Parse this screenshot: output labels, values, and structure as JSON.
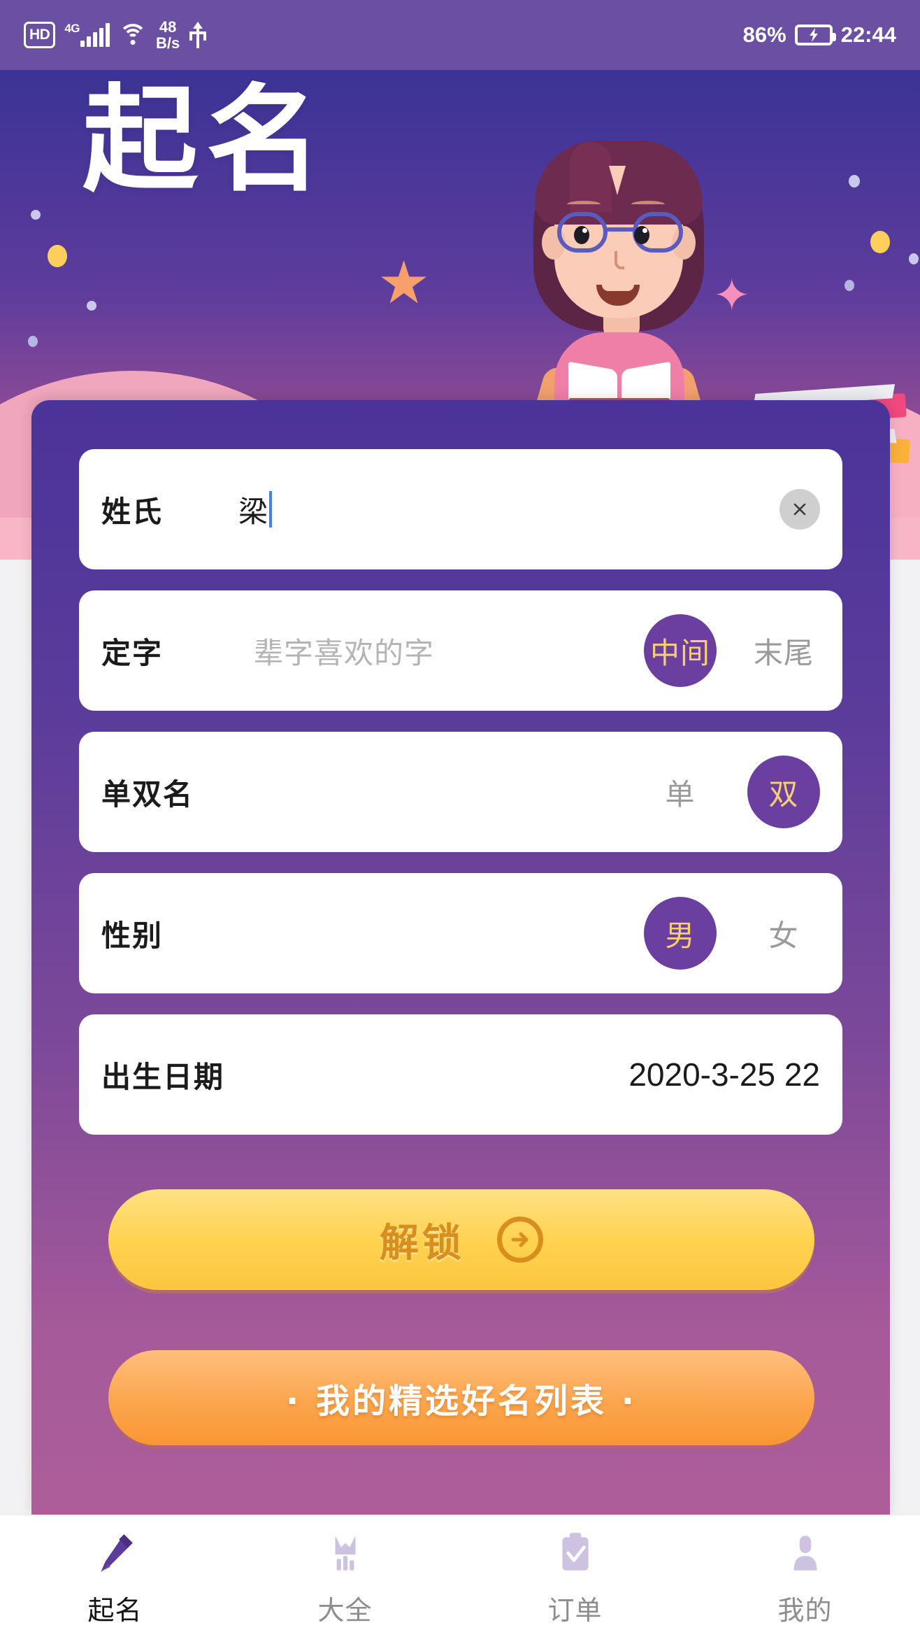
{
  "statusbar": {
    "hd": "HD",
    "network": "4G",
    "speed_value": "48",
    "speed_unit": "B/s",
    "battery_pct": "86%",
    "time": "22:44"
  },
  "hero": {
    "title": "起名"
  },
  "form": {
    "surname": {
      "label": "姓氏",
      "value": "梁",
      "clear_label": "×"
    },
    "fixed_char": {
      "label": "定字",
      "placeholder": "辈字喜欢的字",
      "value": "",
      "options": [
        {
          "label": "中间",
          "selected": true
        },
        {
          "label": "末尾",
          "selected": false
        }
      ]
    },
    "name_length": {
      "label": "单双名",
      "options": [
        {
          "label": "单",
          "selected": false
        },
        {
          "label": "双",
          "selected": true
        }
      ]
    },
    "gender": {
      "label": "性别",
      "options": [
        {
          "label": "男",
          "selected": true
        },
        {
          "label": "女",
          "selected": false
        }
      ]
    },
    "birthdate": {
      "label": "出生日期",
      "value": "2020-3-25 22"
    }
  },
  "actions": {
    "unlock": "解锁",
    "unlock_icon": "arrow-right-circle-icon",
    "my_list": "· 我的精选好名列表 ·"
  },
  "nav": {
    "items": [
      {
        "label": "起名",
        "icon": "pen-icon",
        "active": true
      },
      {
        "label": "大全",
        "icon": "book-collection-icon",
        "active": false
      },
      {
        "label": "订单",
        "icon": "clipboard-check-icon",
        "active": false
      },
      {
        "label": "我的",
        "icon": "person-icon",
        "active": false
      }
    ]
  },
  "colors": {
    "status_bar": "#6a4fa3",
    "hero_top": "#3b3396",
    "panel_top": "#4a3399",
    "panel_bottom": "#ad5e9a",
    "selected_chip": "#6b3fa0",
    "selected_text": "#f7cd74",
    "unlock_button": "#ffd24f",
    "unlock_text": "#d88f1e",
    "list_button": "#fba64d",
    "nav_active": "#5b3c9b",
    "nav_inactive": "#cdc3e0"
  }
}
